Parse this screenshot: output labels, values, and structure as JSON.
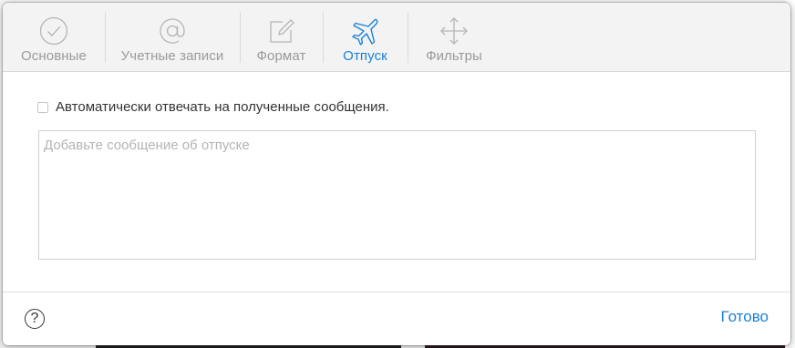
{
  "toolbar": {
    "tabs": [
      {
        "label": "Основные",
        "icon": "checkmark-circle-icon",
        "active": false
      },
      {
        "label": "Учетные записи",
        "icon": "at-sign-icon",
        "active": false
      },
      {
        "label": "Формат",
        "icon": "compose-icon",
        "active": false
      },
      {
        "label": "Отпуск",
        "icon": "airplane-icon",
        "active": true
      },
      {
        "label": "Фильтры",
        "icon": "move-arrows-icon",
        "active": false
      }
    ]
  },
  "vacation": {
    "auto_reply_label": "Автоматически отвечать на полученные сообщения.",
    "auto_reply_checked": false,
    "message_placeholder": "Добавьте сообщение об отпуске",
    "message_value": ""
  },
  "footer": {
    "help_label": "?",
    "done_label": "Готово"
  },
  "colors": {
    "accent": "#1a82d6",
    "inactive": "#9a9a9a",
    "toolbar_bg": "#f3f3f3"
  }
}
